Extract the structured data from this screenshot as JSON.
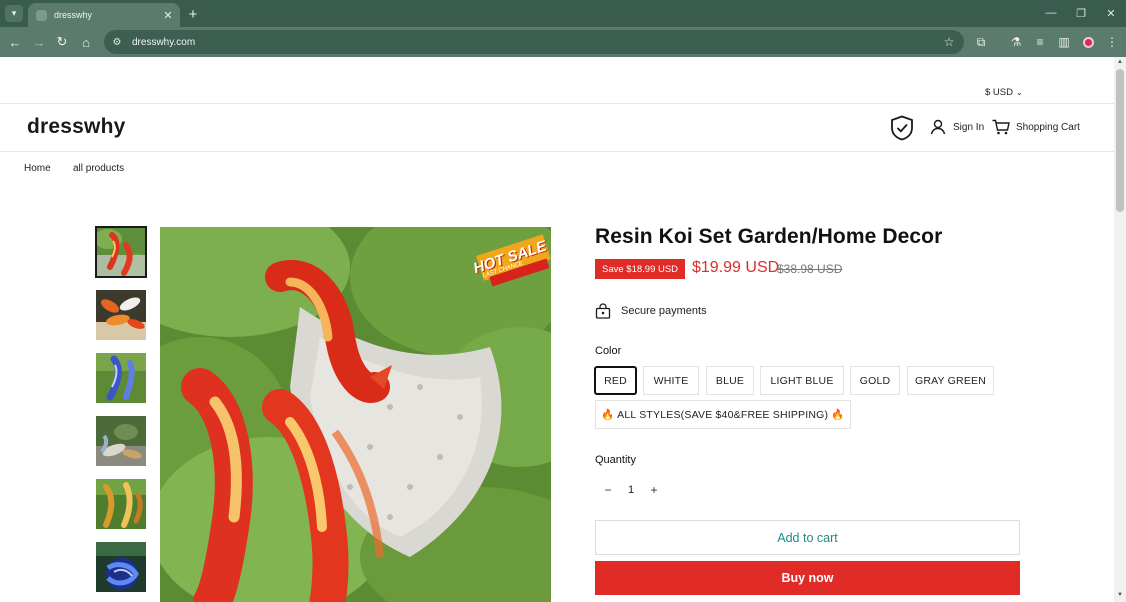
{
  "browser": {
    "tab_title": "dresswhy",
    "url": "dresswhy.com",
    "tab_dropdown_icon": "chevron-down-icon",
    "new_tab_icon": "plus-icon",
    "profile_color": "#e0245e"
  },
  "header": {
    "currency": "$ USD",
    "logo": "dresswhy",
    "sign_in": "Sign In",
    "cart": "Shopping Cart"
  },
  "nav": {
    "items": [
      {
        "label": "Home"
      },
      {
        "label": "all products"
      }
    ]
  },
  "gallery": {
    "thumbnails": [
      {
        "alt": "red koi on hosta leaves",
        "active": true
      },
      {
        "alt": "orange koi set"
      },
      {
        "alt": "blue koi on grass"
      },
      {
        "alt": "koi in garden"
      },
      {
        "alt": "gold koi on grass"
      },
      {
        "alt": "blue koi swirl"
      }
    ],
    "main_badge": {
      "text": "HOT SALE",
      "sub": "LAST CHANCE"
    }
  },
  "product": {
    "title": "Resin Koi Set Garden/Home Decor",
    "save_badge": "Save $18.99 USD",
    "price": "$19.99 USD",
    "compare_price": "$38.98 USD",
    "secure_text": "Secure payments",
    "color_label": "Color",
    "colors": [
      {
        "label": "RED",
        "selected": true
      },
      {
        "label": "WHITE"
      },
      {
        "label": "BLUE"
      },
      {
        "label": "LIGHT BLUE"
      },
      {
        "label": "GOLD"
      },
      {
        "label": "GRAY GREEN"
      },
      {
        "label": "🔥 ALL STYLES(SAVE $40&FREE SHIPPING) 🔥"
      }
    ],
    "quantity_label": "Quantity",
    "quantity": "1",
    "qty_minus": "−",
    "qty_plus": "+",
    "add_to_cart": "Add to cart",
    "buy_now": "Buy now"
  },
  "colors": {
    "chrome": "#3a5c4f",
    "toolbar": "#5a7b6d",
    "sale_red": "#e02b27",
    "teal_text": "#1e8a8a"
  }
}
